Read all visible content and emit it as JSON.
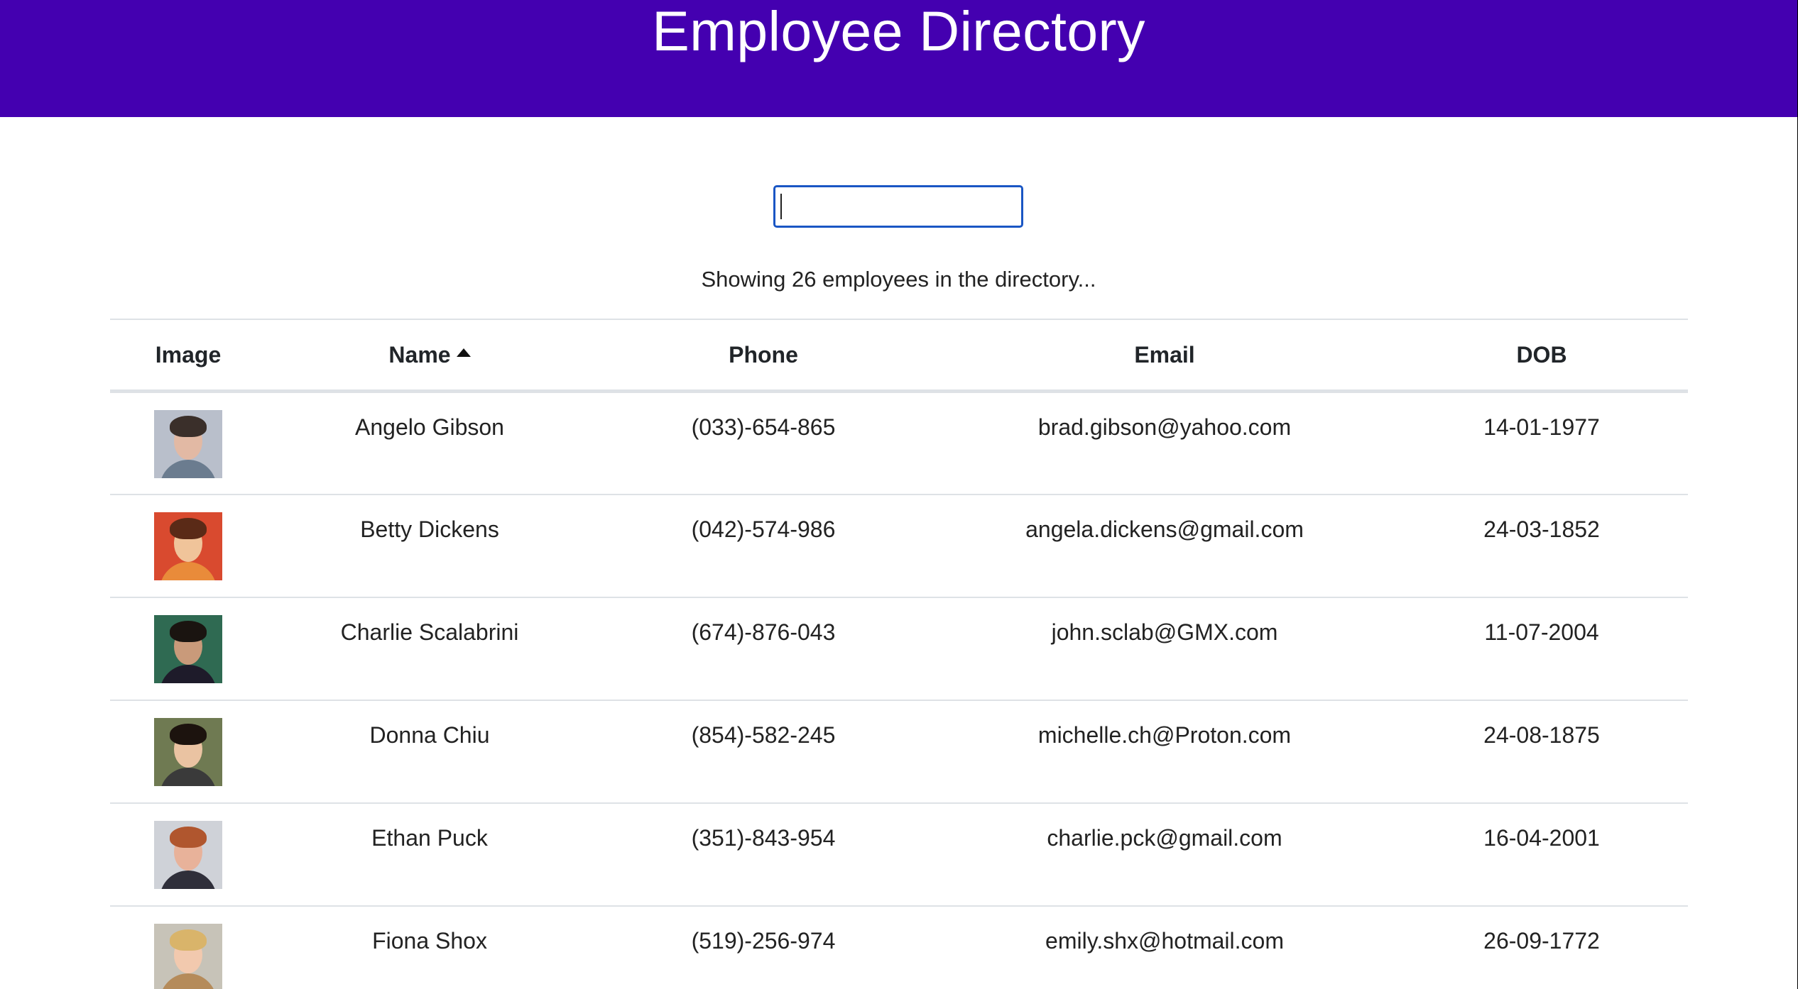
{
  "header": {
    "title": "Employee Directory",
    "background_color": "#4400b0"
  },
  "search": {
    "value": "",
    "placeholder": ""
  },
  "status_text": "Showing 26 employees in the directory...",
  "table": {
    "columns": [
      "Image",
      "Name",
      "Phone",
      "Email",
      "DOB"
    ],
    "sorted_by": "Name",
    "sort_direction": "ascending",
    "rows": [
      {
        "name": "Angelo Gibson",
        "phone": "(033)-654-865",
        "email": "brad.gibson@yahoo.com",
        "dob": "14-01-1977",
        "avatar": {
          "bg": "#b9bfcb",
          "hair": "#3a2f2a",
          "skin": "#e2b9a4",
          "shirt": "#6b7c8f"
        }
      },
      {
        "name": "Betty Dickens",
        "phone": "(042)-574-986",
        "email": "angela.dickens@gmail.com",
        "dob": "24-03-1852",
        "avatar": {
          "bg": "#d94a2f",
          "hair": "#5a2a17",
          "skin": "#f0c49a",
          "shirt": "#e98b3a"
        }
      },
      {
        "name": "Charlie Scalabrini",
        "phone": "(674)-876-043",
        "email": "john.sclab@GMX.com",
        "dob": "11-07-2004",
        "avatar": {
          "bg": "#2f6a52",
          "hair": "#1a1410",
          "skin": "#c99a7a",
          "shirt": "#1e1b2a"
        }
      },
      {
        "name": "Donna Chiu",
        "phone": "(854)-582-245",
        "email": "michelle.ch@Proton.com",
        "dob": "24-08-1875",
        "avatar": {
          "bg": "#6f7a52",
          "hair": "#1c130e",
          "skin": "#eac3a2",
          "shirt": "#3a3a3a"
        }
      },
      {
        "name": "Ethan Puck",
        "phone": "(351)-843-954",
        "email": "charlie.pck@gmail.com",
        "dob": "16-04-2001",
        "avatar": {
          "bg": "#cfd2d8",
          "hair": "#b0562e",
          "skin": "#e8b29a",
          "shirt": "#2f2f3a"
        }
      },
      {
        "name": "Fiona Shox",
        "phone": "(519)-256-974",
        "email": "emily.shx@hotmail.com",
        "dob": "26-09-1772",
        "avatar": {
          "bg": "#c7c3b8",
          "hair": "#d9b46a",
          "skin": "#f2c9ae",
          "shirt": "#b58b5a"
        }
      }
    ]
  }
}
